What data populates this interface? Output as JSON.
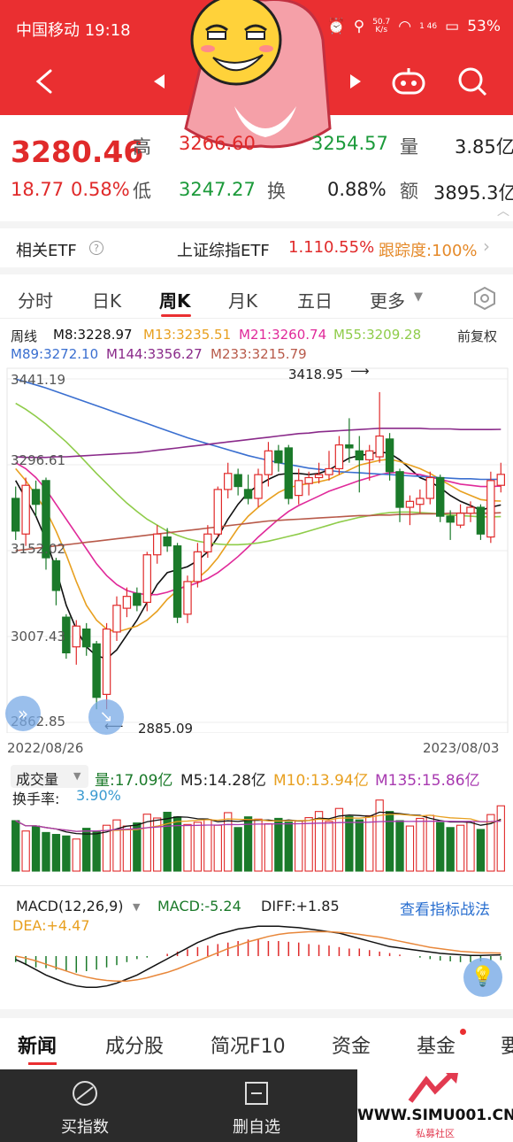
{
  "status_bar": {
    "carrier_time": "中国移动 19:18",
    "net_speed_top": "50.7",
    "net_speed_bottom": "K/s",
    "signal_sub": "1 46",
    "battery": "53%"
  },
  "quote": {
    "price": "3280.46",
    "change": "18.77",
    "change_pct": "0.58%",
    "high_label": "高",
    "high_value": "3266.60",
    "open_value": "3254.57",
    "low_label": "低",
    "low_value": "3247.27",
    "volume_label": "量",
    "volume_value": "3.85亿",
    "turnover_label": "换",
    "turnover_value": "0.88%",
    "amount_label": "额",
    "amount_value": "3895.3亿"
  },
  "etf": {
    "label": "相关ETF",
    "help": "?",
    "name": "上证综指ETF",
    "price": "1.11",
    "pct": "0.55%",
    "tracking": "跟踪度:100%"
  },
  "tabs": [
    "分时",
    "日K",
    "周K",
    "月K",
    "五日",
    "更多"
  ],
  "ma": {
    "period": "周线",
    "m8": "M8:3228.97",
    "m13": "M13:3235.51",
    "m21": "M21:3260.74",
    "m55": "M55:3209.28",
    "adjust": "前复权",
    "m89": "M89:3272.10",
    "m144": "M144:3356.27",
    "m233": "M233:3215.79"
  },
  "axis": {
    "p1": "3441.19",
    "p2": "3296.61",
    "p3": "3152.02",
    "p4": "3007.43",
    "p5": "2862.85",
    "date_start": "2022/08/26",
    "date_end": "2023/08/03",
    "hi_mark": "3418.95",
    "lo_mark": "2885.09"
  },
  "volume": {
    "label": "成交量",
    "vol": "量:17.09亿",
    "m5": "M5:14.28亿",
    "m10": "M10:13.94亿",
    "m135": "M135:15.86亿",
    "turnover": "换手率:",
    "turnover_val": "3.90%"
  },
  "macd": {
    "label": "MACD(12,26,9)",
    "macd": "MACD:-5.24",
    "diff": "DIFF:+1.85",
    "link": "查看指标战法",
    "dea": "DEA:+4.47"
  },
  "bottom_tabs": [
    "新闻",
    "成分股",
    "简况F10",
    "资金",
    "基金",
    "要"
  ],
  "footer": {
    "buy": "买指数",
    "remove": "删自选"
  },
  "watermark": {
    "url": "WWW.SIMU001.CN",
    "sub": "私募社区"
  },
  "colors": {
    "up": "#e02a2a",
    "down": "#1b7a2a",
    "header": "#ea2f31"
  },
  "chart_data": {
    "type": "candlestick",
    "ylim": [
      2862.85,
      3441.19
    ],
    "candles": [
      {
        "o": 3240,
        "c": 3185,
        "h": 3260,
        "l": 3170
      },
      {
        "o": 3180,
        "c": 3262,
        "h": 3275,
        "l": 3160
      },
      {
        "o": 3255,
        "c": 3230,
        "h": 3270,
        "l": 3210
      },
      {
        "o": 3270,
        "c": 3140,
        "h": 3275,
        "l": 3120
      },
      {
        "o": 3135,
        "c": 3085,
        "h": 3140,
        "l": 3060
      },
      {
        "o": 3040,
        "c": 2980,
        "h": 3045,
        "l": 2970
      },
      {
        "o": 2990,
        "c": 3025,
        "h": 3035,
        "l": 2960
      },
      {
        "o": 3020,
        "c": 2990,
        "h": 3030,
        "l": 2975
      },
      {
        "o": 2995,
        "c": 2905,
        "h": 3000,
        "l": 2885
      },
      {
        "o": 2910,
        "c": 3020,
        "h": 3030,
        "l": 2885
      },
      {
        "o": 3015,
        "c": 3060,
        "h": 3075,
        "l": 3000
      },
      {
        "o": 3055,
        "c": 3075,
        "h": 3090,
        "l": 3040
      },
      {
        "o": 3080,
        "c": 3060,
        "h": 3090,
        "l": 3050
      },
      {
        "o": 3065,
        "c": 3145,
        "h": 3150,
        "l": 3050
      },
      {
        "o": 3145,
        "c": 3180,
        "h": 3195,
        "l": 3130
      },
      {
        "o": 3175,
        "c": 3160,
        "h": 3190,
        "l": 3150
      },
      {
        "o": 3160,
        "c": 3040,
        "h": 3165,
        "l": 3030
      },
      {
        "o": 3045,
        "c": 3100,
        "h": 3110,
        "l": 3030
      },
      {
        "o": 3100,
        "c": 3150,
        "h": 3165,
        "l": 3090
      },
      {
        "o": 3150,
        "c": 3180,
        "h": 3195,
        "l": 3140
      },
      {
        "o": 3180,
        "c": 3255,
        "h": 3260,
        "l": 3175
      },
      {
        "o": 3255,
        "c": 3282,
        "h": 3300,
        "l": 3240
      },
      {
        "o": 3280,
        "c": 3260,
        "h": 3290,
        "l": 3245
      },
      {
        "o": 3255,
        "c": 3240,
        "h": 3280,
        "l": 3230
      },
      {
        "o": 3240,
        "c": 3280,
        "h": 3290,
        "l": 3225
      },
      {
        "o": 3280,
        "c": 3320,
        "h": 3335,
        "l": 3260
      },
      {
        "o": 3320,
        "c": 3300,
        "h": 3330,
        "l": 3285
      },
      {
        "o": 3325,
        "c": 3240,
        "h": 3330,
        "l": 3230
      },
      {
        "o": 3245,
        "c": 3270,
        "h": 3290,
        "l": 3230
      },
      {
        "o": 3265,
        "c": 3275,
        "h": 3285,
        "l": 3245
      },
      {
        "o": 3275,
        "c": 3280,
        "h": 3300,
        "l": 3265
      },
      {
        "o": 3280,
        "c": 3290,
        "h": 3320,
        "l": 3270
      },
      {
        "o": 3290,
        "c": 3330,
        "h": 3345,
        "l": 3280
      },
      {
        "o": 3330,
        "c": 3325,
        "h": 3375,
        "l": 3300
      },
      {
        "o": 3320,
        "c": 3305,
        "h": 3345,
        "l": 3250
      },
      {
        "o": 3305,
        "c": 3320,
        "h": 3330,
        "l": 3270
      },
      {
        "o": 3310,
        "c": 3345,
        "h": 3418.95,
        "l": 3300
      },
      {
        "o": 3340,
        "c": 3285,
        "h": 3350,
        "l": 3270
      },
      {
        "o": 3285,
        "c": 3225,
        "h": 3290,
        "l": 3200
      },
      {
        "o": 3225,
        "c": 3235,
        "h": 3245,
        "l": 3195
      },
      {
        "o": 3230,
        "c": 3240,
        "h": 3255,
        "l": 3215
      },
      {
        "o": 3240,
        "c": 3275,
        "h": 3285,
        "l": 3230
      },
      {
        "o": 3275,
        "c": 3210,
        "h": 3280,
        "l": 3200
      },
      {
        "o": 3210,
        "c": 3200,
        "h": 3220,
        "l": 3170
      },
      {
        "o": 3195,
        "c": 3215,
        "h": 3230,
        "l": 3190
      },
      {
        "o": 3215,
        "c": 3225,
        "h": 3235,
        "l": 3200
      },
      {
        "o": 3225,
        "c": 3180,
        "h": 3230,
        "l": 3170
      },
      {
        "o": 3175,
        "c": 3270,
        "h": 3285,
        "l": 3165
      },
      {
        "o": 3262,
        "c": 3280.46,
        "h": 3300,
        "l": 3250
      }
    ],
    "ma_lines": [
      {
        "name": "M8",
        "color": "#111111",
        "values": [
          3270,
          3240,
          3210,
          3170,
          3120,
          3060,
          3020,
          2990,
          2975,
          2970,
          2985,
          3010,
          3035,
          3065,
          3095,
          3115,
          3120,
          3125,
          3135,
          3150,
          3175,
          3205,
          3230,
          3250,
          3262,
          3272,
          3280,
          3282,
          3282,
          3280,
          3282,
          3288,
          3298,
          3308,
          3312,
          3315,
          3318,
          3316,
          3305,
          3290,
          3275,
          3268,
          3258,
          3245,
          3235,
          3228,
          3220,
          3225,
          3228.97
        ]
      },
      {
        "name": "M13",
        "color": "#e8a020",
        "values": [
          3290,
          3270,
          3245,
          3220,
          3185,
          3145,
          3100,
          3060,
          3035,
          3020,
          3015,
          3020,
          3025,
          3035,
          3050,
          3070,
          3085,
          3095,
          3105,
          3120,
          3140,
          3165,
          3190,
          3210,
          3225,
          3238,
          3250,
          3258,
          3262,
          3265,
          3268,
          3272,
          3280,
          3288,
          3296,
          3300,
          3304,
          3306,
          3302,
          3296,
          3290,
          3282,
          3272,
          3262,
          3252,
          3245,
          3238,
          3236,
          3235.51
        ]
      },
      {
        "name": "M21",
        "color": "#e02a9a",
        "values": [
          3300,
          3290,
          3275,
          3255,
          3230,
          3205,
          3180,
          3155,
          3130,
          3110,
          3095,
          3085,
          3080,
          3078,
          3078,
          3082,
          3088,
          3092,
          3098,
          3105,
          3115,
          3128,
          3142,
          3158,
          3175,
          3190,
          3205,
          3218,
          3228,
          3236,
          3244,
          3252,
          3258,
          3264,
          3270,
          3275,
          3280,
          3283,
          3284,
          3282,
          3280,
          3276,
          3272,
          3268,
          3264,
          3262,
          3260,
          3260,
          3260.74
        ]
      },
      {
        "name": "M55",
        "color": "#8fcc4a",
        "values": [
          3400,
          3390,
          3378,
          3365,
          3350,
          3335,
          3318,
          3300,
          3282,
          3265,
          3248,
          3232,
          3218,
          3205,
          3195,
          3185,
          3178,
          3172,
          3168,
          3165,
          3163,
          3162,
          3162,
          3163,
          3165,
          3168,
          3172,
          3176,
          3180,
          3185,
          3190,
          3195,
          3200,
          3204,
          3208,
          3211,
          3214,
          3216,
          3217,
          3217,
          3216,
          3215,
          3214,
          3212,
          3211,
          3210,
          3209,
          3209,
          3209.28
        ]
      },
      {
        "name": "M89",
        "color": "#3a6fd0",
        "values": [
          3441,
          3436,
          3431,
          3426,
          3420,
          3414,
          3408,
          3402,
          3396,
          3390,
          3384,
          3378,
          3372,
          3366,
          3360,
          3354,
          3348,
          3342,
          3337,
          3332,
          3327,
          3322,
          3317,
          3312,
          3308,
          3304,
          3300,
          3297,
          3294,
          3291,
          3289,
          3287,
          3285,
          3284,
          3283,
          3282,
          3281,
          3280,
          3279,
          3278,
          3277,
          3276,
          3275,
          3274,
          3273,
          3273,
          3272,
          3272,
          3272.1
        ]
      },
      {
        "name": "M144",
        "color": "#8a2a8a",
        "values": [
          3310,
          3309,
          3309,
          3309,
          3310,
          3310,
          3311,
          3312,
          3313,
          3314,
          3315,
          3316,
          3317,
          3319,
          3321,
          3323,
          3325,
          3327,
          3329,
          3331,
          3333,
          3335,
          3337,
          3339,
          3341,
          3343,
          3345,
          3347,
          3349,
          3350,
          3352,
          3353,
          3354,
          3355,
          3356,
          3357,
          3358,
          3358,
          3358,
          3358,
          3358,
          3357,
          3357,
          3357,
          3356,
          3356,
          3356,
          3356,
          3356.27
        ]
      },
      {
        "name": "M233",
        "color": "#b85a4a",
        "values": [
          3152,
          3154,
          3156,
          3158,
          3160,
          3162,
          3164,
          3166,
          3168,
          3170,
          3172,
          3174,
          3176,
          3178,
          3180,
          3182,
          3184,
          3186,
          3188,
          3190,
          3192,
          3194,
          3196,
          3198,
          3200,
          3202,
          3203,
          3204,
          3205,
          3206,
          3207,
          3208,
          3209,
          3210,
          3211,
          3211,
          3212,
          3212,
          3213,
          3213,
          3214,
          3214,
          3214,
          3215,
          3215,
          3215,
          3215,
          3215,
          3215.79
        ]
      }
    ],
    "volume": [
      13.2,
      10.5,
      11.8,
      10.1,
      9.6,
      9.2,
      8.4,
      11.2,
      10.4,
      12.0,
      13.4,
      11.8,
      12.6,
      14.9,
      13.9,
      15.4,
      14.2,
      12.2,
      12.8,
      13.5,
      12.0,
      15.3,
      11.4,
      14.2,
      13.6,
      12.4,
      13.8,
      12.8,
      13.1,
      14.0,
      15.6,
      13.0,
      16.4,
      14.3,
      13.4,
      14.5,
      18.6,
      15.6,
      13.2,
      11.8,
      13.8,
      14.6,
      12.7,
      11.4,
      12.0,
      13.0,
      10.9,
      14.8,
      17.09
    ],
    "macd_hist": [
      -8,
      -12,
      -15,
      -16,
      -18,
      -20,
      -22,
      -20,
      -18,
      -15,
      -12,
      -8,
      -4,
      -2,
      0,
      3,
      6,
      9,
      12,
      14,
      16,
      18,
      20,
      22,
      22,
      20,
      20,
      19,
      18,
      16,
      15,
      14,
      12,
      10,
      10,
      8,
      6,
      4,
      2,
      0,
      -2,
      -4,
      -6,
      -7,
      -8,
      -8,
      -7,
      -6,
      -5.24
    ],
    "macd_diff": [
      -5,
      -12,
      -20,
      -28,
      -34,
      -40,
      -44,
      -46,
      -46,
      -44,
      -40,
      -34,
      -28,
      -20,
      -12,
      -4,
      4,
      12,
      20,
      26,
      32,
      36,
      40,
      42,
      44,
      44,
      44,
      43,
      42,
      40,
      38,
      36,
      34,
      30,
      26,
      22,
      18,
      14,
      12,
      10,
      8,
      6,
      4,
      3,
      2,
      1,
      1,
      1.5,
      1.85
    ],
    "macd_dea": [
      0,
      -3,
      -7,
      -12,
      -17,
      -22,
      -27,
      -31,
      -34,
      -36,
      -37,
      -37,
      -35,
      -32,
      -28,
      -24,
      -19,
      -13,
      -7,
      -1,
      5,
      11,
      16,
      21,
      25,
      29,
      32,
      34,
      35,
      36,
      36,
      36,
      35,
      34,
      32,
      30,
      28,
      25,
      22,
      19,
      16,
      13,
      11,
      9,
      7,
      6,
      5,
      4.7,
      4.47
    ]
  }
}
